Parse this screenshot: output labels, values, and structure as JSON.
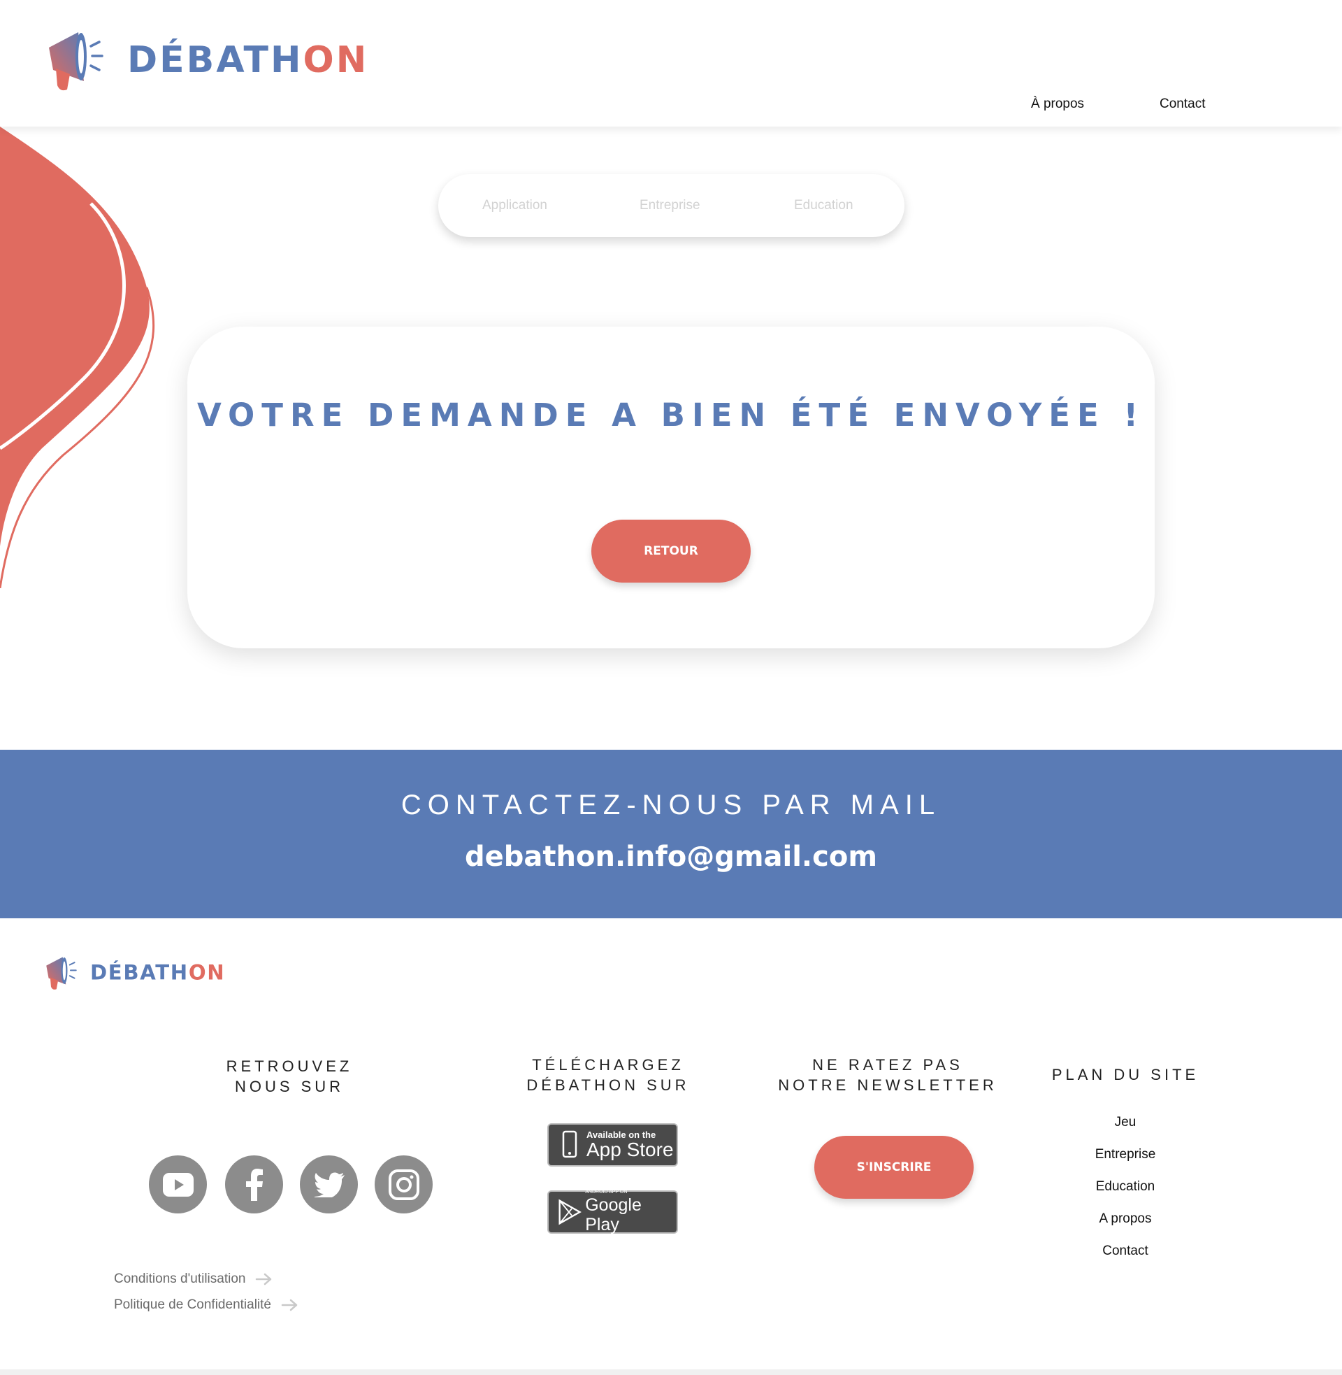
{
  "header": {
    "logo_text_part1": "DÉBATH",
    "logo_text_part2": "ON",
    "nav": [
      "À propos",
      "Contact"
    ]
  },
  "tabs": [
    "Application",
    "Entreprise",
    "Education"
  ],
  "confirmation": {
    "title": "VOTRE DEMANDE A BIEN ÉTÉ ENVOYÉE !",
    "back_label": "RETOUR"
  },
  "contact_band": {
    "title": "CONTACTEZ-NOUS PAR MAIL",
    "email": "debathon.info@gmail.com"
  },
  "footer": {
    "logo_text_part1": "DÉBATH",
    "logo_text_part2": "ON",
    "social_title": "RETROUVEZ\nNOUS SUR",
    "social_icons": [
      "youtube-icon",
      "facebook-icon",
      "twitter-icon",
      "instagram-icon"
    ],
    "download_title": "TÉLÉCHARGEZ\nDÉBATHON SUR",
    "app_store": {
      "small": "Available on the",
      "big": "App Store"
    },
    "google_play": {
      "small": "ANDROID APP ON",
      "big": "Google Play"
    },
    "newsletter_title": "NE RATEZ PAS\nNOTRE NEWSLETTER",
    "newsletter_label": "S'INSCRIRE",
    "plan_title": "PLAN DU SITE",
    "plan_items": [
      "Jeu",
      "Entreprise",
      "Education",
      "A propos",
      "Contact"
    ],
    "legal": [
      "Conditions d'utilisation",
      "Politique de Confidentialité"
    ]
  },
  "colors": {
    "brand_blue": "#5a7bb5",
    "brand_coral": "#e06b60",
    "icon_grey": "#8c8c8c"
  }
}
